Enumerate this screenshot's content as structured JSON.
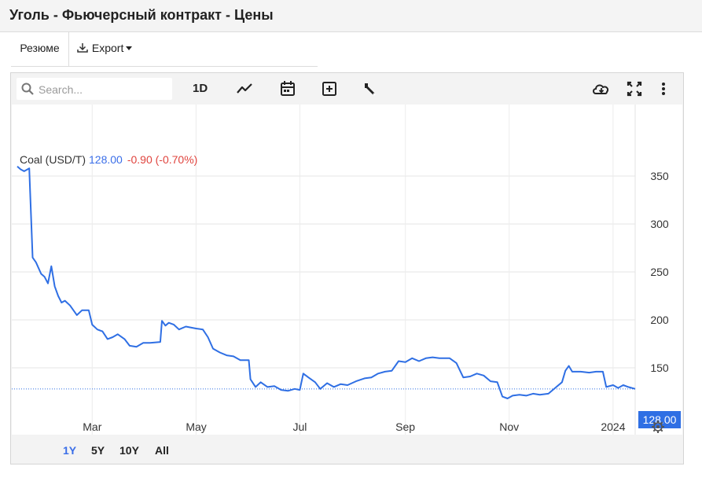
{
  "page": {
    "title": "Уголь - Фьючерсный контракт - Цены"
  },
  "tabs": {
    "resume_label": "Резюме",
    "export_label": "Export"
  },
  "toolbar": {
    "search_placeholder": "Search...",
    "interval_label": "1D",
    "icons": [
      "search-icon",
      "line-chart-icon",
      "calendar-icon",
      "add-box-icon",
      "wrench-icon",
      "cloud-download-icon",
      "fullscreen-icon",
      "more-vertical-icon"
    ]
  },
  "quote": {
    "name": "Coal (USD/T)",
    "price": "128.00",
    "change": "-0.90 (-0.70%)"
  },
  "price_tag": "128.00",
  "ranges": [
    {
      "label": "1Y",
      "active": true
    },
    {
      "label": "5Y",
      "active": false
    },
    {
      "label": "10Y",
      "active": false
    },
    {
      "label": "All",
      "active": false
    }
  ],
  "colors": {
    "line": "#2f6fe4",
    "accent": "#3a6ee8",
    "negative": "#e0443e"
  },
  "chart_data": {
    "type": "line",
    "series": [
      {
        "name": "Coal (USD/T)",
        "points": [
          [
            "2023-01-16",
            360
          ],
          [
            "2023-01-18",
            357
          ],
          [
            "2023-01-20",
            355
          ],
          [
            "2023-01-23",
            358
          ],
          [
            "2023-01-25",
            265
          ],
          [
            "2023-01-27",
            260
          ],
          [
            "2023-01-30",
            248
          ],
          [
            "2023-02-01",
            245
          ],
          [
            "2023-02-03",
            238
          ],
          [
            "2023-02-05",
            256
          ],
          [
            "2023-02-07",
            235
          ],
          [
            "2023-02-09",
            225
          ],
          [
            "2023-02-11",
            218
          ],
          [
            "2023-02-13",
            220
          ],
          [
            "2023-02-16",
            215
          ],
          [
            "2023-02-20",
            205
          ],
          [
            "2023-02-23",
            210
          ],
          [
            "2023-02-27",
            210
          ],
          [
            "2023-03-01",
            195
          ],
          [
            "2023-03-04",
            190
          ],
          [
            "2023-03-07",
            188
          ],
          [
            "2023-03-10",
            180
          ],
          [
            "2023-03-13",
            182
          ],
          [
            "2023-03-16",
            185
          ],
          [
            "2023-03-20",
            180
          ],
          [
            "2023-03-23",
            173
          ],
          [
            "2023-03-27",
            172
          ],
          [
            "2023-03-31",
            176
          ],
          [
            "2023-04-04",
            176
          ],
          [
            "2023-04-10",
            177
          ],
          [
            "2023-04-11",
            199
          ],
          [
            "2023-04-13",
            194
          ],
          [
            "2023-04-15",
            197
          ],
          [
            "2023-04-18",
            195
          ],
          [
            "2023-04-21",
            190
          ],
          [
            "2023-04-25",
            193
          ],
          [
            "2023-05-01",
            191
          ],
          [
            "2023-05-05",
            190
          ],
          [
            "2023-05-08",
            182
          ],
          [
            "2023-05-11",
            170
          ],
          [
            "2023-05-15",
            166
          ],
          [
            "2023-05-19",
            163
          ],
          [
            "2023-05-23",
            162
          ],
          [
            "2023-05-27",
            158
          ],
          [
            "2023-06-01",
            158
          ],
          [
            "2023-06-02",
            138
          ],
          [
            "2023-06-05",
            130
          ],
          [
            "2023-06-08",
            135
          ],
          [
            "2023-06-12",
            130
          ],
          [
            "2023-06-16",
            131
          ],
          [
            "2023-06-20",
            127
          ],
          [
            "2023-06-24",
            126
          ],
          [
            "2023-06-28",
            128
          ],
          [
            "2023-07-01",
            127
          ],
          [
            "2023-07-03",
            144
          ],
          [
            "2023-07-06",
            140
          ],
          [
            "2023-07-10",
            135
          ],
          [
            "2023-07-13",
            128
          ],
          [
            "2023-07-17",
            134
          ],
          [
            "2023-07-21",
            130
          ],
          [
            "2023-07-25",
            133
          ],
          [
            "2023-07-29",
            132
          ],
          [
            "2023-08-03",
            136
          ],
          [
            "2023-08-08",
            139
          ],
          [
            "2023-08-12",
            140
          ],
          [
            "2023-08-16",
            144
          ],
          [
            "2023-08-20",
            146
          ],
          [
            "2023-08-24",
            147
          ],
          [
            "2023-08-28",
            157
          ],
          [
            "2023-09-01",
            156
          ],
          [
            "2023-09-05",
            160
          ],
          [
            "2023-09-09",
            157
          ],
          [
            "2023-09-13",
            160
          ],
          [
            "2023-09-17",
            161
          ],
          [
            "2023-09-21",
            160
          ],
          [
            "2023-09-27",
            160
          ],
          [
            "2023-10-01",
            155
          ],
          [
            "2023-10-05",
            140
          ],
          [
            "2023-10-09",
            141
          ],
          [
            "2023-10-13",
            144
          ],
          [
            "2023-10-17",
            142
          ],
          [
            "2023-10-21",
            136
          ],
          [
            "2023-10-25",
            135
          ],
          [
            "2023-10-28",
            120
          ],
          [
            "2023-10-31",
            118
          ],
          [
            "2023-11-03",
            121
          ],
          [
            "2023-11-07",
            122
          ],
          [
            "2023-11-11",
            121
          ],
          [
            "2023-11-15",
            123
          ],
          [
            "2023-11-19",
            122
          ],
          [
            "2023-11-24",
            123
          ],
          [
            "2023-11-28",
            129
          ],
          [
            "2023-12-02",
            135
          ],
          [
            "2023-12-04",
            147
          ],
          [
            "2023-12-06",
            152
          ],
          [
            "2023-12-08",
            146
          ],
          [
            "2023-12-13",
            146
          ],
          [
            "2023-12-18",
            145
          ],
          [
            "2023-12-22",
            146
          ],
          [
            "2023-12-26",
            146
          ],
          [
            "2023-12-28",
            130
          ],
          [
            "2024-01-01",
            132
          ],
          [
            "2024-01-04",
            129
          ],
          [
            "2024-01-07",
            132
          ],
          [
            "2024-01-10",
            130
          ],
          [
            "2024-01-14",
            128
          ]
        ]
      }
    ],
    "x_ticks": [
      {
        "label": "Mar",
        "date": "2023-03-01"
      },
      {
        "label": "May",
        "date": "2023-05-01"
      },
      {
        "label": "Jul",
        "date": "2023-07-01"
      },
      {
        "label": "Sep",
        "date": "2023-09-01"
      },
      {
        "label": "Nov",
        "date": "2023-11-01"
      },
      {
        "label": "2024",
        "date": "2024-01-01"
      }
    ],
    "y_ticks": [
      150,
      200,
      250,
      300,
      350
    ],
    "ylim": [
      100,
      400
    ],
    "last_value": 128.0,
    "grid": true
  }
}
